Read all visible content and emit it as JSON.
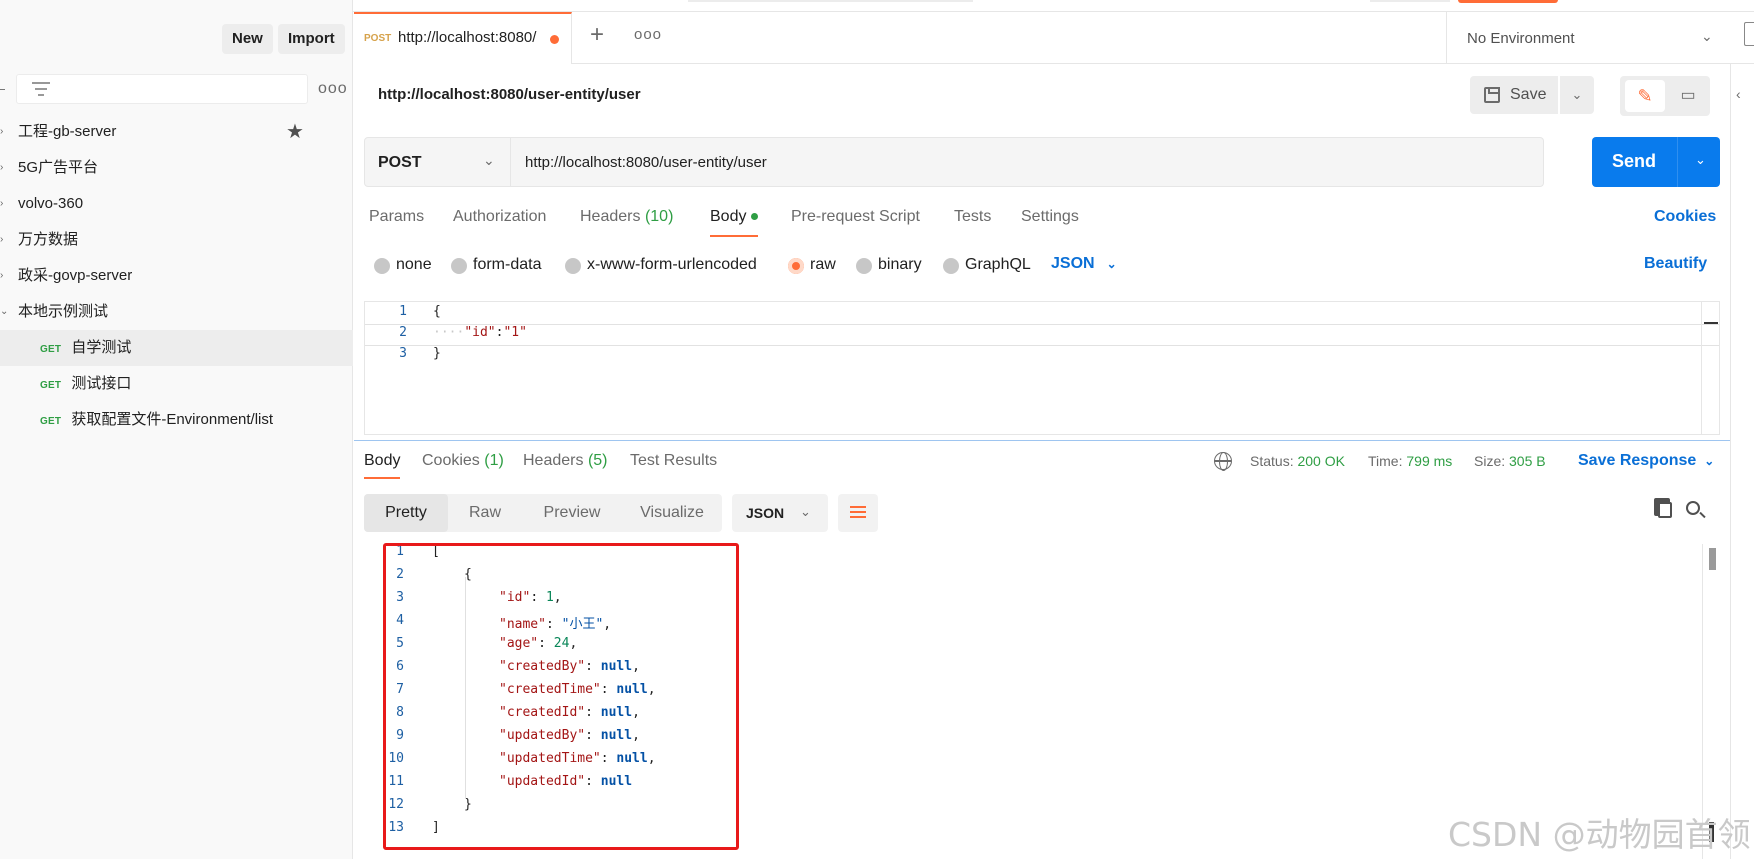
{
  "sidebar": {
    "new_label": "New",
    "import_label": "Import",
    "more_label": "ooo",
    "collections": [
      {
        "label": "工程-gb-server",
        "starred": true
      },
      {
        "label": "5G广告平台"
      },
      {
        "label": "volvo-360"
      },
      {
        "label": "万方数据"
      },
      {
        "label": "政采-govp-server"
      },
      {
        "label": "本地示例测试",
        "expanded": true
      }
    ],
    "requests": [
      {
        "method": "GET",
        "label": "自学测试",
        "active": true
      },
      {
        "method": "GET",
        "label": "测试接口"
      },
      {
        "method": "GET",
        "label": "获取配置文件-Environment/list"
      }
    ]
  },
  "tab": {
    "method": "POST",
    "url": "http://localhost:8080/",
    "plus": "+",
    "more": "ooo"
  },
  "environment": {
    "label": "No Environment"
  },
  "request": {
    "title": "http://localhost:8080/user-entity/user",
    "save_label": "Save",
    "method": "POST",
    "url": "http://localhost:8080/user-entity/user",
    "send_label": "Send",
    "tabs": {
      "params": "Params",
      "authorization": "Authorization",
      "headers": "Headers",
      "headers_count": "(10)",
      "body": "Body",
      "prerequest": "Pre-request Script",
      "tests": "Tests",
      "settings": "Settings"
    },
    "cookies_label": "Cookies",
    "body_types": {
      "none": "none",
      "form_data": "form-data",
      "urlencoded": "x-www-form-urlencoded",
      "raw": "raw",
      "binary": "binary",
      "graphql": "GraphQL"
    },
    "body_format": "JSON",
    "beautify_label": "Beautify",
    "body_lines": {
      "l1": {
        "num": "1",
        "text": "{"
      },
      "l2": {
        "num": "2",
        "dots": "····",
        "key": "\"id\"",
        "colon": ":",
        "val": "\"1\""
      },
      "l3": {
        "num": "3",
        "text": "}"
      }
    }
  },
  "response": {
    "tabs": {
      "body": "Body",
      "cookies": "Cookies",
      "cookies_count": "(1)",
      "headers": "Headers",
      "headers_count": "(5)",
      "tests": "Test Results"
    },
    "status_label": "Status:",
    "status_value": "200 OK",
    "time_label": "Time:",
    "time_value": "799 ms",
    "size_label": "Size:",
    "size_value": "305 B",
    "save_response_label": "Save Response",
    "views": {
      "pretty": "Pretty",
      "raw": "Raw",
      "preview": "Preview",
      "visualize": "Visualize"
    },
    "format": "JSON",
    "lines": {
      "l1": {
        "num": "1",
        "text": "["
      },
      "l2": {
        "num": "2",
        "text": "{"
      },
      "l3": {
        "num": "3",
        "key": "\"id\"",
        "val": "1"
      },
      "l4": {
        "num": "4",
        "key": "\"name\"",
        "val": "\"小王\""
      },
      "l5": {
        "num": "5",
        "key": "\"age\"",
        "val": "24"
      },
      "l6": {
        "num": "6",
        "key": "\"createdBy\"",
        "val": "null"
      },
      "l7": {
        "num": "7",
        "key": "\"createdTime\"",
        "val": "null"
      },
      "l8": {
        "num": "8",
        "key": "\"createdId\"",
        "val": "null"
      },
      "l9": {
        "num": "9",
        "key": "\"updatedBy\"",
        "val": "null"
      },
      "l10": {
        "num": "10",
        "key": "\"updatedTime\"",
        "val": "null"
      },
      "l11": {
        "num": "11",
        "key": "\"updatedId\"",
        "val": "null"
      },
      "l12": {
        "num": "12",
        "text": "}"
      },
      "l13": {
        "num": "13",
        "text": "]"
      }
    }
  },
  "watermark": "CSDN @动物园首领",
  "colors": {
    "accent": "#ff6c37",
    "send": "#097bed",
    "link": "#0a6fd6",
    "success": "#2f9e44",
    "highlight_box": "#e8191a"
  }
}
